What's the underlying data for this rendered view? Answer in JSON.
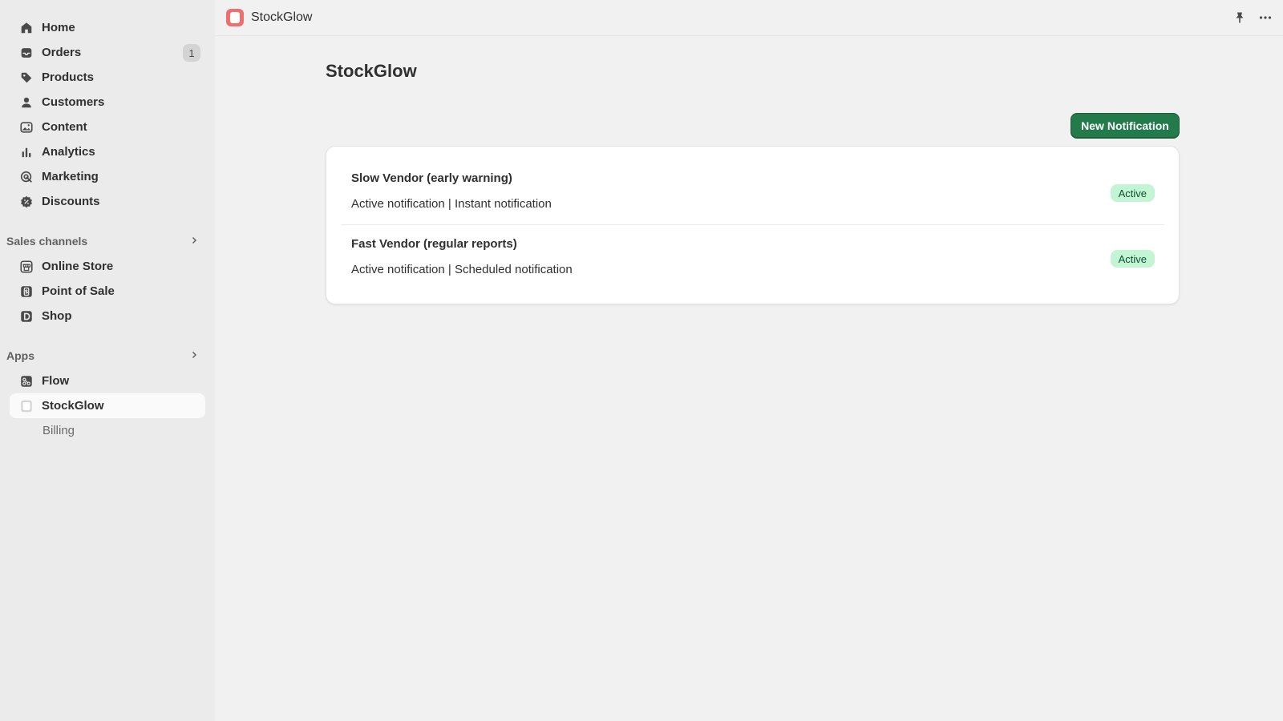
{
  "sidebar": {
    "main_items": [
      {
        "label": "Home",
        "icon": "home-icon"
      },
      {
        "label": "Orders",
        "icon": "inbox-icon",
        "badge": "1"
      },
      {
        "label": "Products",
        "icon": "tag-icon"
      },
      {
        "label": "Customers",
        "icon": "person-icon"
      },
      {
        "label": "Content",
        "icon": "image-icon"
      },
      {
        "label": "Analytics",
        "icon": "bar-chart-icon"
      },
      {
        "label": "Marketing",
        "icon": "target-icon"
      },
      {
        "label": "Discounts",
        "icon": "discount-icon"
      }
    ],
    "sales_channels": {
      "header": "Sales channels",
      "items": [
        {
          "label": "Online Store",
          "icon": "store-icon"
        },
        {
          "label": "Point of Sale",
          "icon": "pos-icon"
        },
        {
          "label": "Shop",
          "icon": "shop-icon"
        }
      ]
    },
    "apps": {
      "header": "Apps",
      "items": [
        {
          "label": "Flow",
          "icon": "flow-icon"
        },
        {
          "label": "StockGlow",
          "icon": "stockglow-icon",
          "selected": true
        }
      ],
      "sub_items": [
        {
          "label": "Billing"
        }
      ]
    }
  },
  "topbar": {
    "app_name": "StockGlow",
    "logo_color": "#ef6f6f"
  },
  "main": {
    "page_title": "StockGlow",
    "new_button_label": "New Notification",
    "notifications": [
      {
        "title": "Slow Vendor (early warning)",
        "subtitle": "Active notification | Instant notification",
        "status": "Active"
      },
      {
        "title": "Fast Vendor (regular reports)",
        "subtitle": "Active notification | Scheduled notification",
        "status": "Active"
      }
    ]
  },
  "colors": {
    "primary": "#237b4b",
    "badge_success_bg": "#c3f5d4",
    "badge_success_text": "#0c5132",
    "sidebar_bg": "#ebebeb",
    "page_bg": "#f1f1f1"
  }
}
